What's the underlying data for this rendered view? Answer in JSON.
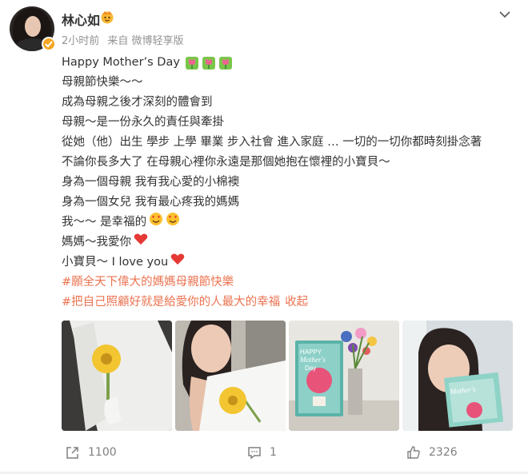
{
  "post": {
    "author": "林心如",
    "time": "2小时前",
    "source": "来自 微博轻享版",
    "lines": [
      "Happy Mother’s Day",
      "母親節快樂～～",
      "成為母親之後才深刻的體會到",
      "母親～是一份永久的責任與牽掛",
      "從她（他）出生 學步 上學 畢業 步入社會 進入家庭 … 一切的一切你都時刻掛念著",
      "不論你長多大了 在母親心裡你永遠是那個她抱在懷裡的小寶貝～",
      "身為一個母親  我有我心愛的小棉襖",
      "身為一個女兒  我有最心疼我的媽媽",
      "我～～ 是幸福的",
      "媽媽～我愛你",
      "小寶貝～ I love you"
    ],
    "hashtags": [
      "#願全天下偉大的媽媽母親節快樂",
      "#把自己照顧好就是給愛你的人最大的幸福"
    ],
    "collapse_label": "收起",
    "photo_texts": {
      "card_line1": "HAPPY",
      "card_line2": "Mother's",
      "card_line3": "Day"
    }
  },
  "footer": {
    "repost_count": "1100",
    "comment_count": "1",
    "like_count": "2326"
  },
  "colors": {
    "hashtag": "#eb7350",
    "meta": "#939393",
    "verified": "#f5a623"
  },
  "icons": [
    "verified-badge-icon",
    "vip-crown-icon",
    "chevron-down-icon",
    "tulip-emoji-icon",
    "smiling-hearts-emoji-icon",
    "red-heart-emoji-icon",
    "repost-icon",
    "comment-icon",
    "like-icon"
  ]
}
